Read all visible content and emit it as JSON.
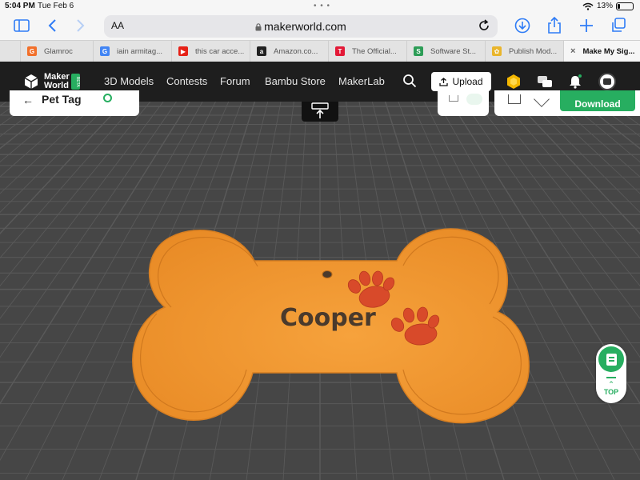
{
  "status_bar": {
    "time": "5:04 PM",
    "date": "Tue Feb 6",
    "battery": "13%"
  },
  "browser": {
    "text_size_label": "AA",
    "url": "makerworld.com",
    "tabs": [
      {
        "label": "Glamroc",
        "favicon": "G",
        "color": "#f2702b"
      },
      {
        "label": "iain armitag...",
        "favicon": "G",
        "color": "#4285f4"
      },
      {
        "label": "this car acce...",
        "favicon": "▶",
        "color": "#e62117"
      },
      {
        "label": "Amazon.co...",
        "favicon": "a",
        "color": "#222222"
      },
      {
        "label": "The Official...",
        "favicon": "T",
        "color": "#e31937"
      },
      {
        "label": "Software St...",
        "favicon": "S",
        "color": "#2d9d57"
      },
      {
        "label": "Publish Mod...",
        "favicon": "✿",
        "color": "#e9b52c"
      },
      {
        "label": "Make My Sig...",
        "favicon": "×",
        "color": "#888888"
      }
    ]
  },
  "site": {
    "logo_line1": "Maker",
    "logo_line2": "World",
    "logo_badge": "BETA",
    "nav": [
      "3D Models",
      "Contests",
      "Forum",
      "Bambu Store",
      "MakerLab"
    ],
    "upload_label": "Upload"
  },
  "editor": {
    "title": "Pet Tag",
    "download_label": "Download",
    "tag_name": "Cooper",
    "top_label": "TOP"
  },
  "colors": {
    "tag": "#f0952f",
    "paw": "#d84a2a",
    "accent": "#27ae60"
  }
}
